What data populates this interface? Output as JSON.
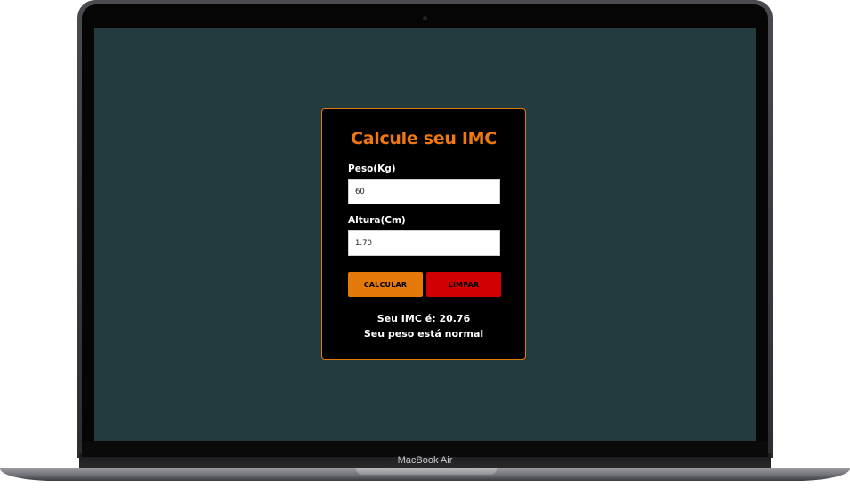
{
  "device": {
    "model_label": "MacBook Air"
  },
  "app": {
    "title": "Calcule seu IMC",
    "weight": {
      "label": "Peso(Kg)",
      "value": "60"
    },
    "height": {
      "label": "Altura(Cm)",
      "value": "1.70"
    },
    "buttons": {
      "calculate": "CALCULAR",
      "clear": "LIMPAR"
    },
    "result": {
      "imc_line": "Seu IMC é: 20.76",
      "status_line": "Seu peso está normal"
    }
  },
  "colors": {
    "accent": "#f0780f",
    "screen_bg": "#233b3c",
    "card_bg": "#000000",
    "clear_button": "#d00000"
  }
}
